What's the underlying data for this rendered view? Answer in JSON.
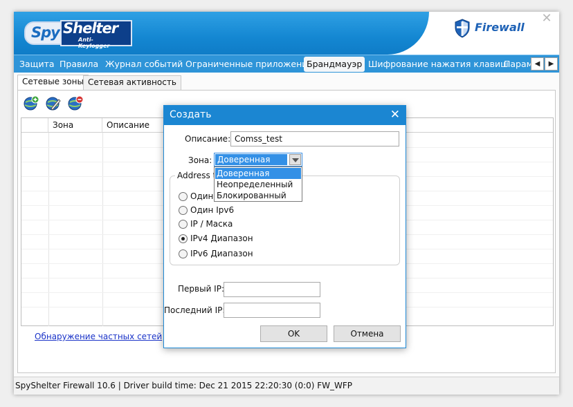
{
  "app": {
    "logo_spy": "Spy",
    "logo_shelter": "Shelter",
    "logo_tagline": "Anti-Keylogger",
    "brand": "Firewall",
    "close_glyph": "✕"
  },
  "menu": {
    "items": [
      {
        "label": "Защита"
      },
      {
        "label": "Правила"
      },
      {
        "label": "Журнал событий"
      },
      {
        "label": "Ограниченные приложения"
      },
      {
        "label": "Брандмауэр"
      },
      {
        "label": "Шифрование нажатия клавиш"
      },
      {
        "label": "Парам"
      }
    ],
    "active_index": 4,
    "scroll_left": "◀",
    "scroll_right": "▶"
  },
  "subtabs": [
    {
      "label": "Сетевые зоны"
    },
    {
      "label": "Сетевая активность"
    }
  ],
  "toolbar": {
    "icons": [
      "add-zone-icon",
      "edit-zone-icon",
      "remove-zone-icon"
    ]
  },
  "grid": {
    "columns": [
      "",
      "Зона",
      "Описание"
    ]
  },
  "private_link": "Обнаружение частных сетей",
  "statusbar": "SpyShelter Firewall 10.6  |  Driver build time: Dec 21 2015 22:20:30  (0:0) FW_WFP",
  "dialog": {
    "title": "Создать",
    "close_glyph": "✕",
    "description_label": "Описание:",
    "description_value": "Comss_test",
    "zone_label": "Зона:",
    "zone_selected": "Доверенная",
    "zone_options": [
      "Доверенная",
      "Неопределенный",
      "Блокированный"
    ],
    "address_type_label": "Address t",
    "address_types": [
      {
        "label": "Один",
        "checked": false
      },
      {
        "label": "Один Ipv6",
        "checked": false
      },
      {
        "label": "IP / Маска",
        "checked": false
      },
      {
        "label": "IPv4 Диапазон",
        "checked": true
      },
      {
        "label": "IPv6 Диапазон",
        "checked": false
      }
    ],
    "first_ip_label": "Первый IP:",
    "first_ip_value": "",
    "last_ip_label": "Последний IP:",
    "last_ip_value": "",
    "ok_label": "OK",
    "cancel_label": "Отмена"
  },
  "colors": {
    "accent": "#1b86d2",
    "header_blue": "#1487d2",
    "menu_blue": "#2e94d8",
    "link": "#1a33c8"
  }
}
